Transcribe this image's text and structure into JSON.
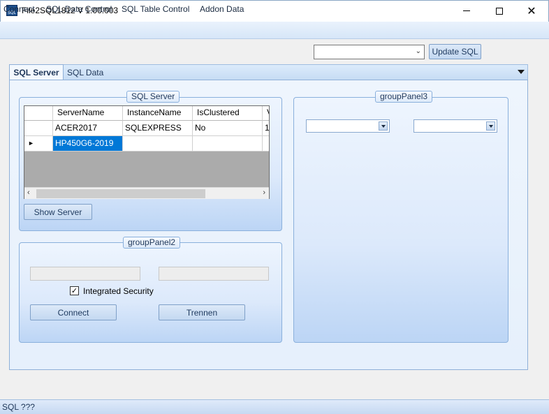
{
  "window": {
    "title": "File2SQL1812 V 1.00.003",
    "controls": {
      "minimize": "—",
      "maximize": "□",
      "close": "✕"
    }
  },
  "menu": {
    "items": [
      {
        "label": "Connect"
      },
      {
        "label": "SQL Data Control"
      },
      {
        "label": "SQL Table Control"
      },
      {
        "label": "Addon Data"
      }
    ]
  },
  "toolbar": {
    "combo_value": "",
    "update_label": "Update SQL"
  },
  "tabs": {
    "items": [
      {
        "label": "SQL Server",
        "active": true
      },
      {
        "label": "SQL Data",
        "active": false
      }
    ]
  },
  "server_panel": {
    "caption": "SQL Server",
    "grid": {
      "columns": [
        "ServerName",
        "InstanceName",
        "IsClustered",
        "V"
      ],
      "rows": [
        [
          "ACER2017",
          "SQLEXPRESS",
          "No",
          "1"
        ],
        [
          "HP450G6-2019",
          "",
          "",
          ""
        ]
      ],
      "current_row_marker": "►"
    },
    "show_button": "Show Server"
  },
  "panel2": {
    "caption": "groupPanel2",
    "user_field": "",
    "password_field": "",
    "integrated_security_label": "Integrated Security",
    "integrated_security_checked": true,
    "connect_button": "Connect",
    "disconnect_button": "Trennen"
  },
  "panel3": {
    "caption": "groupPanel3",
    "combo1": "",
    "combo2": ""
  },
  "status": {
    "text": "SQL ???"
  },
  "colors": {
    "accent": "#0078d7",
    "panel_border": "#8ab0dc",
    "menu_bg": "#d6e6f8"
  }
}
